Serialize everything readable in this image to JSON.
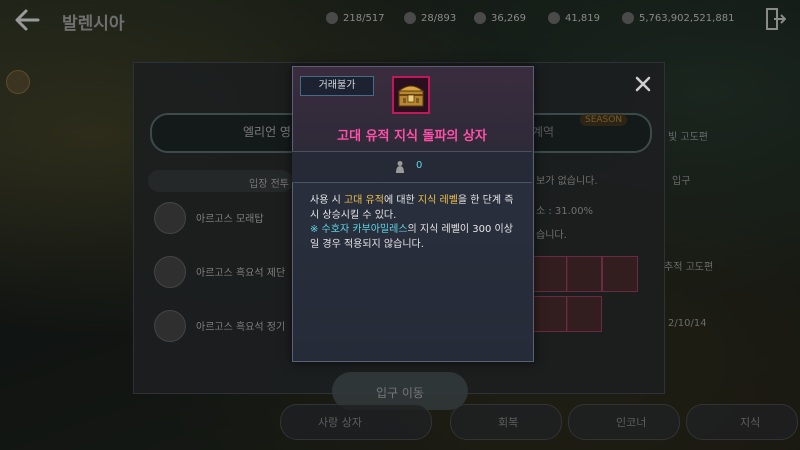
{
  "header": {
    "region_title": "발렌시아",
    "resources": [
      {
        "icon": "inventory-icon",
        "value": "218/517"
      },
      {
        "icon": "weight-icon",
        "value": "28/893"
      },
      {
        "icon": "contribution-icon",
        "value": "36,269"
      },
      {
        "icon": "energy-icon",
        "value": "41,819"
      },
      {
        "icon": "silver-icon",
        "value": "5,763,902,521,881"
      }
    ]
  },
  "panel": {
    "tab_left": "엘리언 영",
    "tab_right": "계역",
    "season_tag": "SEASON",
    "entry_header": "입장 전투",
    "dungeons": [
      {
        "label": "아르고스 모래탑"
      },
      {
        "label": "아르고스 흑요석 제단"
      },
      {
        "label": "아르고스 흑요석 정기"
      }
    ],
    "right_texts": [
      "보가 없습니다.",
      "소 : 31.00%",
      "습니다."
    ],
    "far_right": [
      "빛 고도편",
      "입구",
      "추적 고도편",
      "2/10/14"
    ],
    "enter_button": "입구 이동",
    "bottom_items": [
      "사랑 상자",
      "회복",
      "인코너",
      "지식"
    ]
  },
  "tooltip": {
    "trade_badge": "거래불가",
    "item_name": "고대 유적 지식 돌파의 상자",
    "owned_count": "0",
    "desc": {
      "p1": "사용 시 ",
      "h1": "고대 유적",
      "p2": "에 대한 ",
      "h2": "지식 레벨",
      "p3": "을 한 단계 즉시 상승시킬 수 있다.",
      "n1": "※ 수호자 카부아밀레스",
      "p4": "의 지식 레벨이 300 이상일 경우 적용되지 않습니다."
    }
  },
  "colors": {
    "item_name": "#ff4fa8",
    "highlight": "#f0c04a",
    "note": "#5fd6e6",
    "item_border": "#c2185b"
  }
}
